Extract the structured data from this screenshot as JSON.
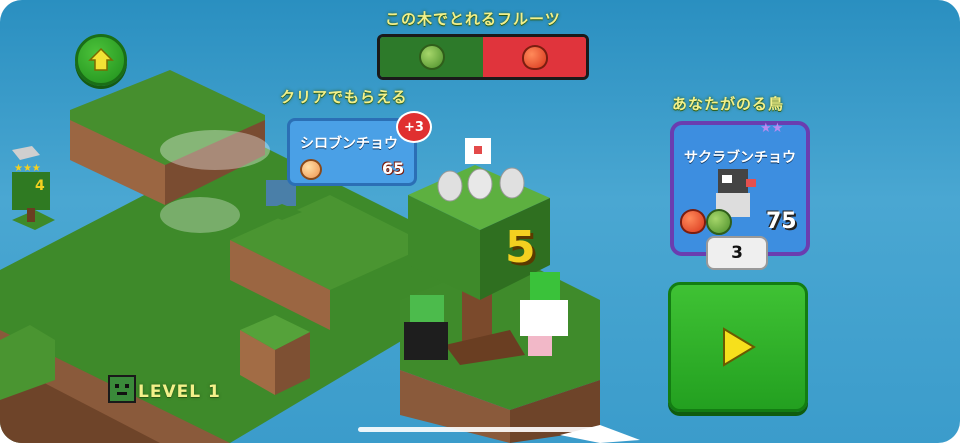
{
  "hud": {
    "fruits_heading": "この木でとれるフルーツ",
    "clear_reward_heading": "クリアでもらえる",
    "your_island_heading": "あなたがのる鳥",
    "level_label": "LEVEL 1",
    "fruit_bar": {
      "left_color": "#2d7a2a",
      "right_color": "#e0343c",
      "left_fruit": "melon-icon",
      "right_fruit": "apple-icon"
    }
  },
  "reward_card": {
    "bird_name": "シロブンチョウ",
    "value": "65",
    "bonus": "+3",
    "fruit": "peach-icon"
  },
  "island_card": {
    "bird_name": "サクラブンチョウ",
    "stars": "★★",
    "value": "75",
    "count": "3",
    "fruits": [
      "apple-icon",
      "melon-icon"
    ]
  },
  "tree": {
    "number": "5"
  },
  "mini_tree": {
    "number": "4",
    "stars": "★★★"
  },
  "colors": {
    "accent_text": "#f3f08a",
    "play_button": "#2fb12a",
    "card_border": "#6a3db0"
  }
}
